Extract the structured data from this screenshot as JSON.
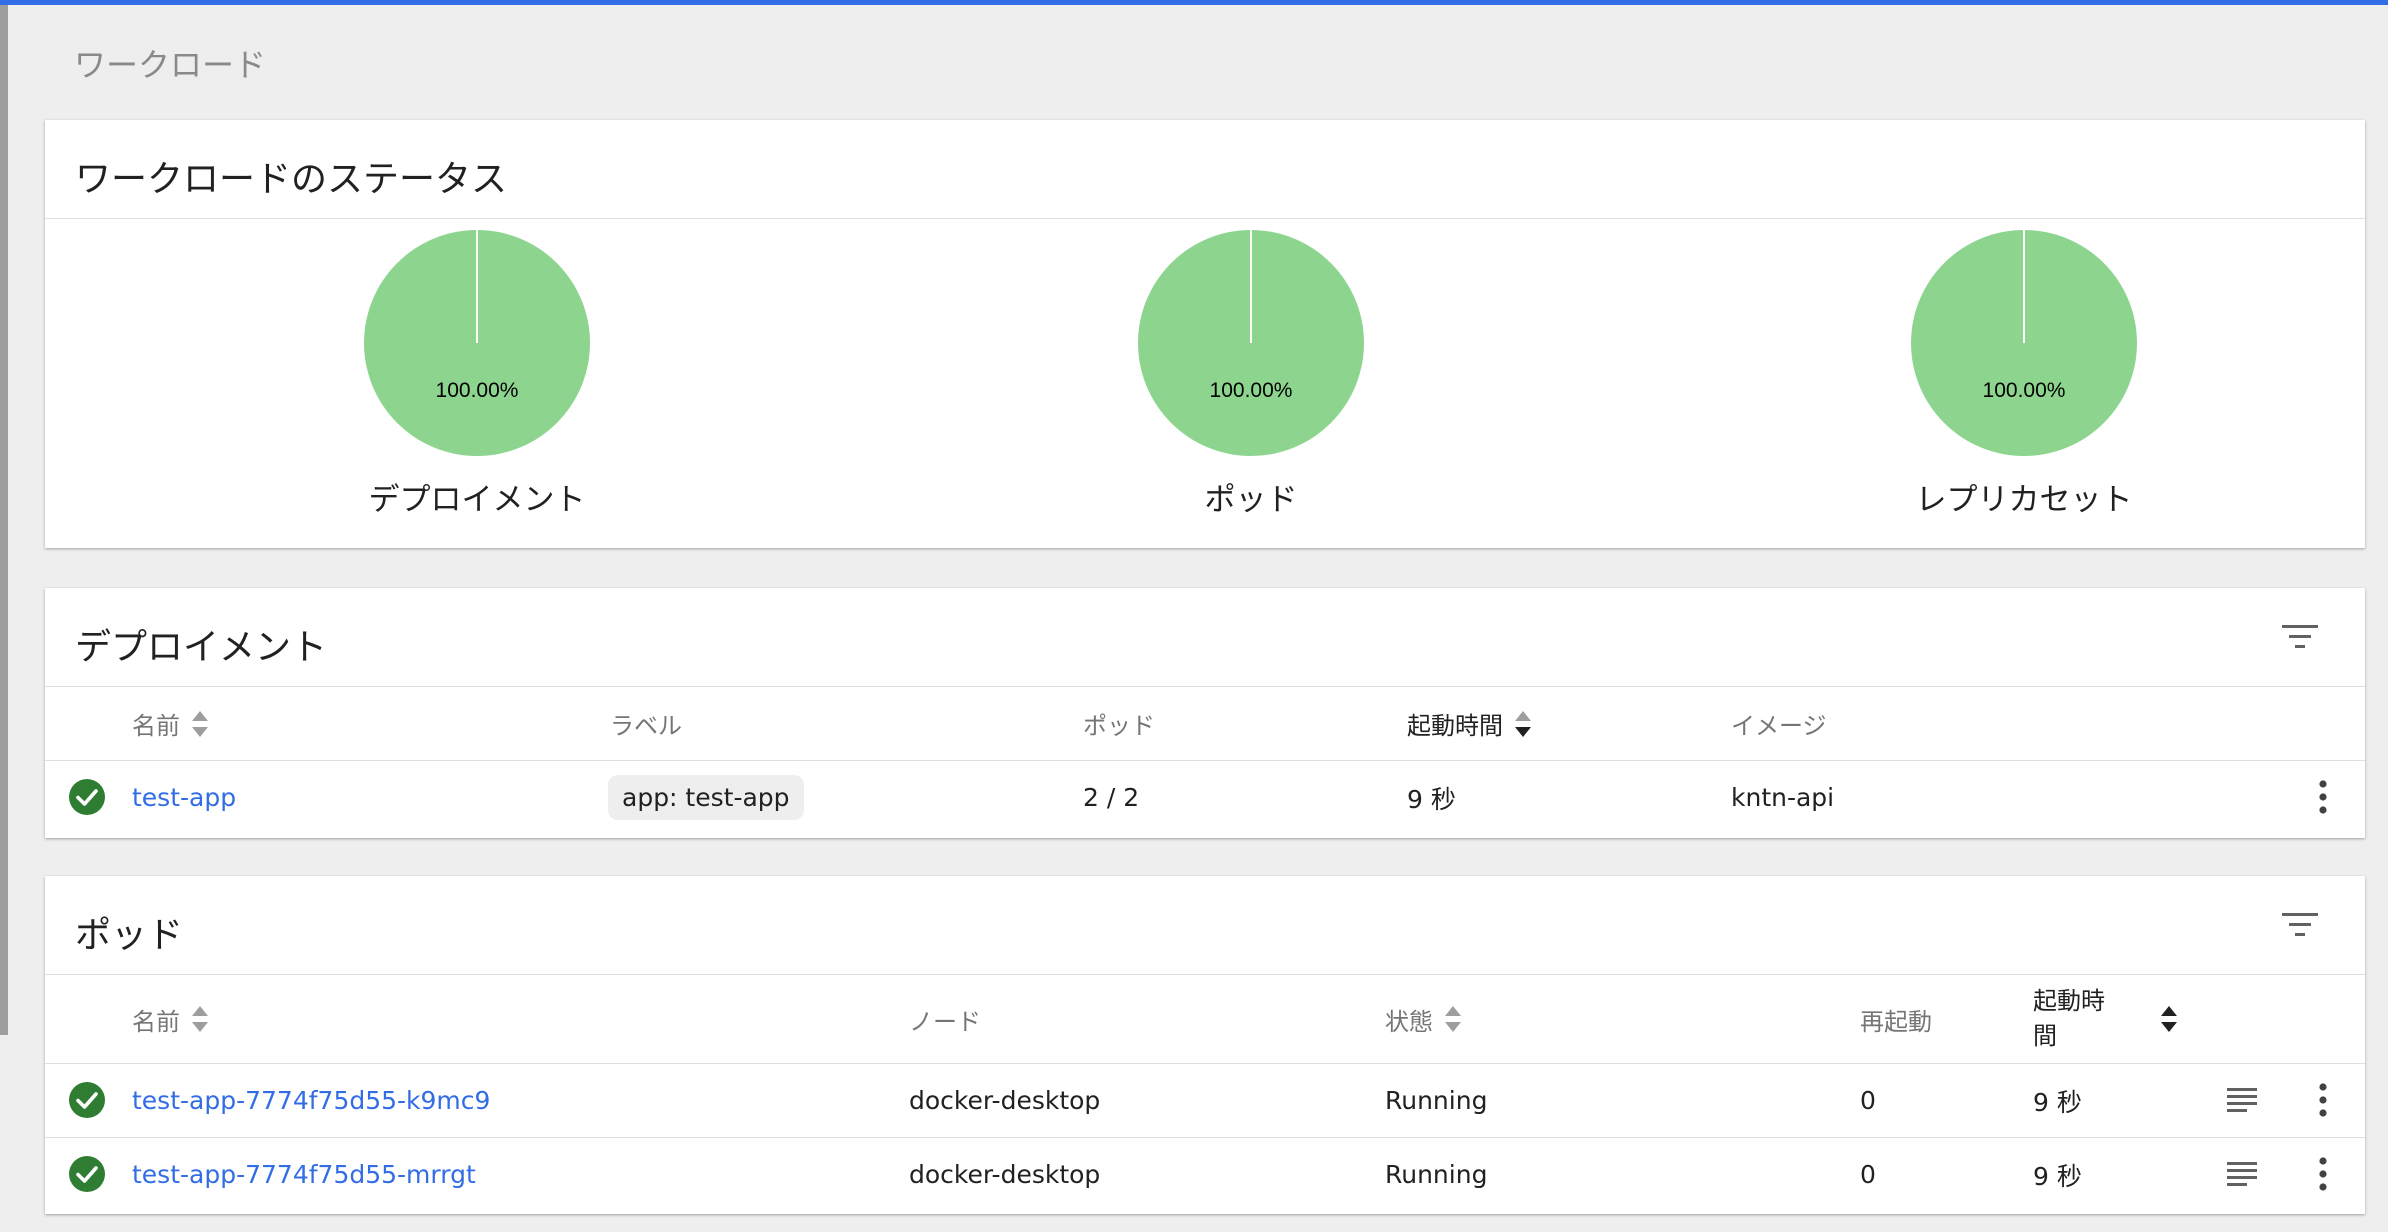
{
  "page": {
    "title": "ワークロード"
  },
  "colors": {
    "accent": "#326de6",
    "pie_ok": "#8dd58f",
    "status_ok": "#2e7d32",
    "link": "#326de6"
  },
  "workload_status": {
    "title": "ワークロードのステータス",
    "charts": [
      {
        "label": "デプロイメント",
        "percent_text": "100.00%",
        "value": 100
      },
      {
        "label": "ポッド",
        "percent_text": "100.00%",
        "value": 100
      },
      {
        "label": "レプリカセット",
        "percent_text": "100.00%",
        "value": 100
      }
    ]
  },
  "deployments": {
    "title": "デプロイメント",
    "filter_icon": "filter-list-icon",
    "columns": {
      "name": "名前",
      "labels": "ラベル",
      "pods": "ポッド",
      "age": "起動時間",
      "images": "イメージ"
    },
    "rows": [
      {
        "status": "ok",
        "name": "test-app",
        "label": "app: test-app",
        "pods": "2 / 2",
        "age": "9 秒",
        "image": "kntn-api"
      }
    ]
  },
  "pods": {
    "title": "ポッド",
    "filter_icon": "filter-list-icon",
    "columns": {
      "name": "名前",
      "node": "ノード",
      "status": "状態",
      "restarts": "再起動",
      "age_line1": "起動時",
      "age_line2": "間"
    },
    "rows": [
      {
        "status": "ok",
        "name": "test-app-7774f75d55-k9mc9",
        "node": "docker-desktop",
        "state": "Running",
        "restarts": "0",
        "age": "9 秒"
      },
      {
        "status": "ok",
        "name": "test-app-7774f75d55-mrrgt",
        "node": "docker-desktop",
        "state": "Running",
        "restarts": "0",
        "age": "9 秒"
      }
    ]
  }
}
